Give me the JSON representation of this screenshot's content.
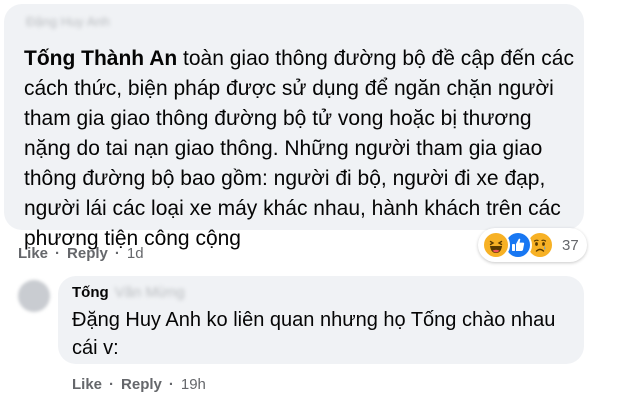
{
  "comment": {
    "author_blurred": "Đặng Huy Anh",
    "mention": "Tống Thành An",
    "text": " toàn giao thông đường bộ đề cập đến các cách thức, biện pháp được sử dụng để ngăn chặn người tham gia giao thông đường bộ tử vong hoặc bị thương nặng do tai nạn giao thông. Những người tham gia giao thông đường bộ bao gồm: người đi bộ, người đi xe đạp, người lái các loại xe máy khác nhau, hành khách trên các phương tiện công cộng",
    "actions": {
      "like_label": "Like",
      "reply_label": "Reply",
      "time": "1d"
    },
    "reactions": {
      "icons": [
        "haha-icon",
        "like-icon",
        "sad-icon"
      ],
      "count": "37"
    }
  },
  "reply": {
    "author_visible": "Tống",
    "author_blurred": "Văn Mừng",
    "text": "Đặng Huy Anh ko liên quan nhưng họ Tống chào nhau cái v:",
    "actions": {
      "like_label": "Like",
      "reply_label": "Reply",
      "time": "19h"
    }
  },
  "colors": {
    "bubble": "#f0f2f5",
    "text": "#050505",
    "secondary": "#65676b",
    "like_blue": "#1877f2",
    "emoji_yellow": "#f7b125"
  }
}
